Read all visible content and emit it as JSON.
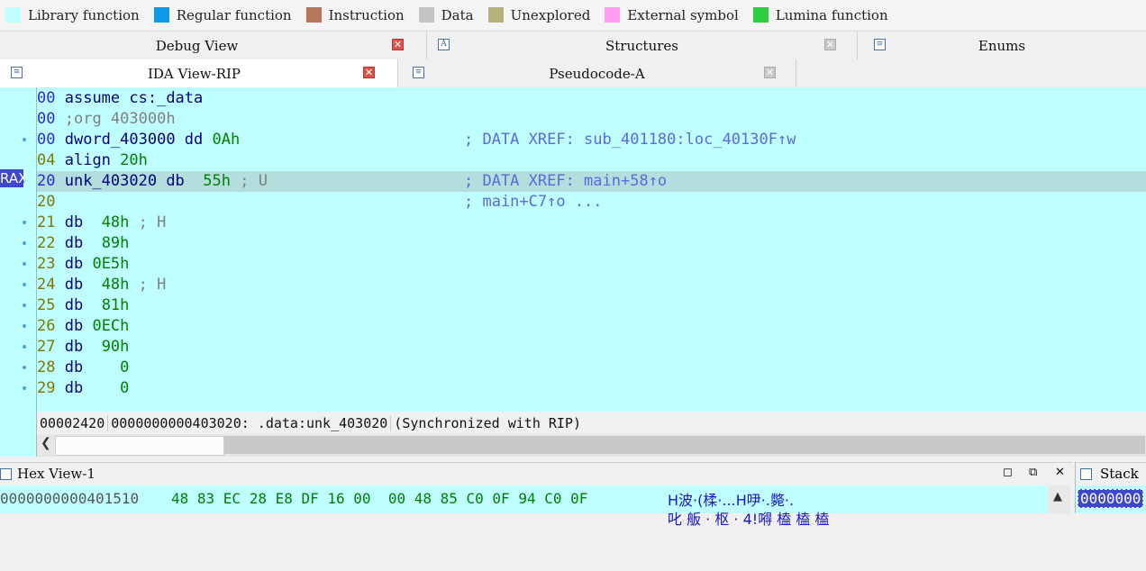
{
  "legend": [
    {
      "label": "Library function",
      "color": "#c0ffff"
    },
    {
      "label": "Regular function",
      "color": "#0e9ae6"
    },
    {
      "label": "Instruction",
      "color": "#b8765a"
    },
    {
      "label": "Data",
      "color": "#c4c4c4"
    },
    {
      "label": "Unexplored",
      "color": "#b7b07a"
    },
    {
      "label": "External symbol",
      "color": "#ff9cf3"
    },
    {
      "label": "Lumina function",
      "color": "#2ecc40"
    }
  ],
  "tabs_top": {
    "debug_view": "Debug View",
    "structures": "Structures",
    "enums": "Enums"
  },
  "tabs_second": {
    "ida_view": "IDA View-RIP",
    "pseudocode": "Pseudocode-A"
  },
  "register_marker": "RAX",
  "lines": [
    {
      "addr": "00",
      "code": "assume cs:_data",
      "xref": ""
    },
    {
      "addr": "00",
      "code": ";org 403000h",
      "xref": ""
    },
    {
      "addr": "00",
      "code": "dword_403000 dd 0Ah",
      "xref": "; DATA XREF: sub_401180:loc_40130F↑w"
    },
    {
      "addr": "04",
      "code": "align 20h",
      "xref": ""
    },
    {
      "addr": "20",
      "code": "unk_403020 db  55h ; U",
      "xref": "; DATA XREF: main+58↑o"
    },
    {
      "addr": "20",
      "code": "",
      "xref": "; main+C7↑o ..."
    },
    {
      "addr": "21",
      "code": "db  48h ; H",
      "xref": ""
    },
    {
      "addr": "22",
      "code": "db  89h",
      "xref": ""
    },
    {
      "addr": "23",
      "code": "db 0E5h",
      "xref": ""
    },
    {
      "addr": "24",
      "code": "db  48h ; H",
      "xref": ""
    },
    {
      "addr": "25",
      "code": "db  81h",
      "xref": ""
    },
    {
      "addr": "26",
      "code": "db 0ECh",
      "xref": ""
    },
    {
      "addr": "27",
      "code": "db  90h",
      "xref": ""
    },
    {
      "addr": "28",
      "code": "db    0",
      "xref": ""
    },
    {
      "addr": "29",
      "code": "db    0",
      "xref": ""
    }
  ],
  "status": {
    "offset": "00002420",
    "location": "0000000000403020: .data:unk_403020",
    "sync": "(Synchronized with RIP)"
  },
  "hex_view": {
    "title": "Hex View-1",
    "address": "0000000000401510",
    "bytes": "48 83 EC 28 E8 DF 16 00  00 48 85 C0 0F 94 C0 0F",
    "ascii": "H波·(楺·...H吚·.斃·.",
    "ascii_next": "叱 舨 · 枢 · 4!嘚 榼 榼 榼"
  },
  "stack_view": {
    "title": "Stack",
    "value": "0000000"
  }
}
